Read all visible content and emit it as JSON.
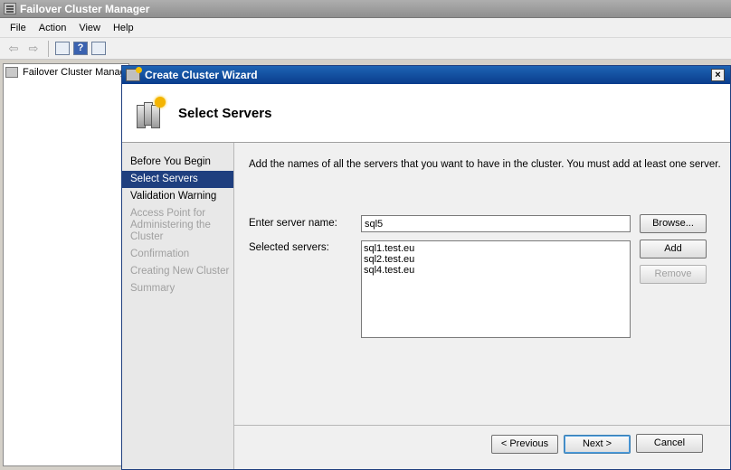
{
  "app": {
    "title": "Failover Cluster Manager"
  },
  "menu": [
    "File",
    "Action",
    "View",
    "Help"
  ],
  "toolbar": {
    "help_glyph": "?"
  },
  "tree": {
    "root_label": "Failover Cluster Manag"
  },
  "wizard": {
    "title": "Create Cluster Wizard",
    "close_glyph": "×",
    "heading": "Select Servers",
    "steps": [
      {
        "label": "Before You Begin",
        "state": "done"
      },
      {
        "label": "Select Servers",
        "state": "active"
      },
      {
        "label": "Validation Warning",
        "state": "done"
      },
      {
        "label": "Access Point for Administering the Cluster",
        "state": "disabled"
      },
      {
        "label": "Confirmation",
        "state": "disabled"
      },
      {
        "label": "Creating New Cluster",
        "state": "disabled"
      },
      {
        "label": "Summary",
        "state": "disabled"
      }
    ],
    "intro": "Add the names of all the servers that you want to have in the cluster. You must add at least one server.",
    "server_name_label": "Enter server name:",
    "server_name_value": "sql5",
    "selected_label": "Selected servers:",
    "selected_servers": [
      "sql1.test.eu",
      "sql2.test.eu",
      "sql4.test.eu"
    ],
    "buttons": {
      "browse": "Browse...",
      "add": "Add",
      "remove": "Remove",
      "previous": "< Previous",
      "next": "Next >",
      "cancel": "Cancel"
    }
  },
  "colors": {
    "accent": "#1f3f7f",
    "title_bar": "#0a3c8c"
  }
}
